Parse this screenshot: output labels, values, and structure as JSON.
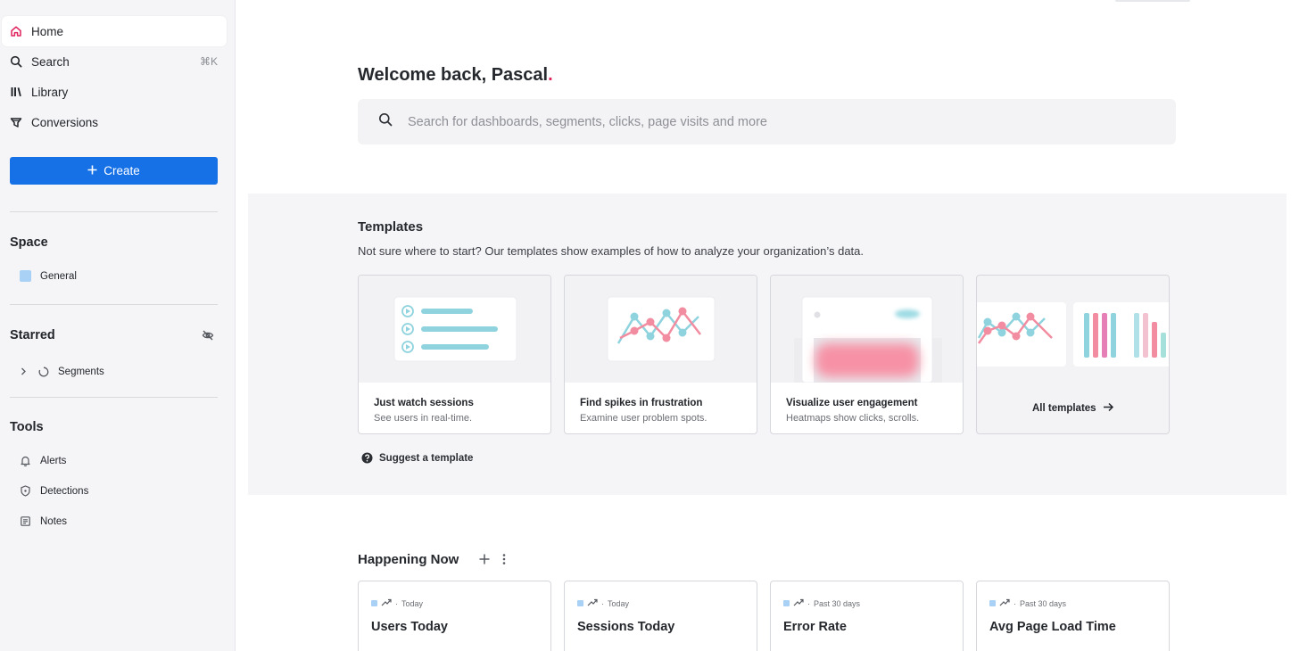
{
  "sidebar": {
    "nav": [
      {
        "label": "Home",
        "icon": "home-icon"
      },
      {
        "label": "Search",
        "icon": "search-icon",
        "shortcut": "⌘K"
      },
      {
        "label": "Library",
        "icon": "library-icon"
      },
      {
        "label": "Conversions",
        "icon": "conversions-icon"
      }
    ],
    "create_label": "Create",
    "space": {
      "title": "Space",
      "items": [
        {
          "label": "General",
          "color": "#a9d0f5"
        }
      ]
    },
    "starred": {
      "title": "Starred",
      "items": [
        {
          "label": "Segments"
        }
      ]
    },
    "tools": {
      "title": "Tools",
      "items": [
        {
          "label": "Alerts",
          "icon": "bell-icon"
        },
        {
          "label": "Detections",
          "icon": "shield-icon"
        },
        {
          "label": "Notes",
          "icon": "notes-icon"
        }
      ]
    }
  },
  "main": {
    "welcome_prefix": "Welcome back, Pascal",
    "welcome_dot": ".",
    "search_placeholder": "Search for dashboards, segments, clicks, page visits and more",
    "templates": {
      "title": "Templates",
      "description": "Not sure where to start? Our templates show examples of how to analyze your organization’s data.",
      "cards": [
        {
          "title": "Just watch sessions",
          "subtitle": "See users in real-time."
        },
        {
          "title": "Find spikes in frustration",
          "subtitle": "Examine user problem spots."
        },
        {
          "title": "Visualize user engagement",
          "subtitle": "Heatmaps show clicks, scrolls."
        }
      ],
      "all_label": "All templates",
      "suggest_label": "Suggest a template"
    },
    "happening_now": {
      "title": "Happening Now",
      "cards": [
        {
          "period": "Today",
          "title": "Users Today"
        },
        {
          "period": "Today",
          "title": "Sessions Today"
        },
        {
          "period": "Past 30 days",
          "title": "Error Rate"
        },
        {
          "period": "Past 30 days",
          "title": "Avg Page Load Time"
        }
      ]
    }
  },
  "colors": {
    "accent": "#1671e6",
    "brand_dot": "#e0245e",
    "teal": "#8fd3de",
    "pink": "#f28ca0"
  }
}
